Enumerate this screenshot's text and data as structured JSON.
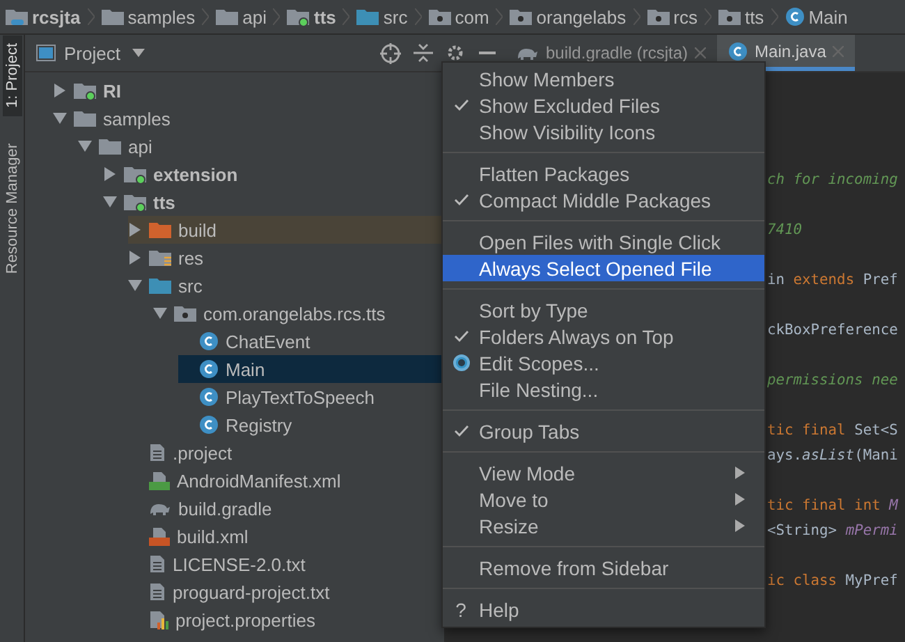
{
  "breadcrumb": [
    {
      "label": "rcsjta",
      "kind": "project"
    },
    {
      "label": "samples",
      "kind": "folder"
    },
    {
      "label": "api",
      "kind": "folder"
    },
    {
      "label": "tts",
      "kind": "module"
    },
    {
      "label": "src",
      "kind": "src"
    },
    {
      "label": "com",
      "kind": "package"
    },
    {
      "label": "orangelabs",
      "kind": "package"
    },
    {
      "label": "rcs",
      "kind": "package"
    },
    {
      "label": "tts",
      "kind": "package"
    },
    {
      "label": "Main",
      "kind": "class"
    }
  ],
  "tool_strip": [
    {
      "label": "1: Project",
      "selected": true
    },
    {
      "label": "Resource Manager",
      "selected": false
    }
  ],
  "project_panel": {
    "title": "Project"
  },
  "editor_tabs": [
    {
      "label": "build.gradle (rcsjta)",
      "kind": "gradle",
      "selected": false
    },
    {
      "label": "Main.java",
      "kind": "class",
      "selected": true
    }
  ],
  "tree": [
    {
      "label": "RI",
      "kind": "module",
      "expanded": false,
      "selected": false
    },
    {
      "label": "samples",
      "kind": "folder",
      "expanded": true,
      "selected": false,
      "children": [
        {
          "label": "api",
          "kind": "folder",
          "expanded": true,
          "selected": false,
          "children": [
            {
              "label": "extension",
              "kind": "module",
              "expanded": false,
              "selected": false
            },
            {
              "label": "tts",
              "kind": "module",
              "expanded": true,
              "selected": false,
              "children": [
                {
                  "label": "build",
                  "kind": "excluded",
                  "expanded": false,
                  "selected": false
                },
                {
                  "label": "res",
                  "kind": "res",
                  "expanded": false,
                  "selected": false
                },
                {
                  "label": "src",
                  "kind": "src",
                  "expanded": true,
                  "selected": false,
                  "children": [
                    {
                      "label": "com.orangelabs.rcs.tts",
                      "kind": "package",
                      "expanded": true,
                      "selected": false,
                      "children": [
                        {
                          "label": "ChatEvent",
                          "kind": "class",
                          "selected": false
                        },
                        {
                          "label": "Main",
                          "kind": "class",
                          "selected": true
                        },
                        {
                          "label": "PlayTextToSpeech",
                          "kind": "class",
                          "selected": false
                        },
                        {
                          "label": "Registry",
                          "kind": "class",
                          "selected": false
                        }
                      ]
                    }
                  ]
                },
                {
                  "label": ".project",
                  "kind": "file",
                  "selected": false
                },
                {
                  "label": "AndroidManifest.xml",
                  "kind": "manifest",
                  "selected": false
                },
                {
                  "label": "build.gradle",
                  "kind": "gradle",
                  "selected": false
                },
                {
                  "label": "build.xml",
                  "kind": "xml",
                  "selected": false
                },
                {
                  "label": "LICENSE-2.0.txt",
                  "kind": "file",
                  "selected": false
                },
                {
                  "label": "proguard-project.txt",
                  "kind": "file",
                  "selected": false
                },
                {
                  "label": "project.properties",
                  "kind": "properties",
                  "selected": false
                }
              ]
            }
          ]
        }
      ]
    }
  ],
  "code_blocks": [
    [
      [
        {
          "text": "ch for incoming",
          "kind": "comment"
        }
      ]
    ],
    [
      [
        {
          "text": "7410",
          "kind": "comment"
        }
      ]
    ],
    [
      [
        {
          "text": "in ",
          "kind": "plain"
        },
        {
          "text": "extends",
          "kind": "keyword"
        },
        {
          "text": " Pref",
          "kind": "plain"
        }
      ]
    ],
    [
      [
        {
          "text": "ckBoxPreference",
          "kind": "plain"
        }
      ]
    ],
    [
      [
        {
          "text": "permissions nee",
          "kind": "comment"
        }
      ]
    ],
    [
      [
        {
          "text": "tic final",
          "kind": "keyword"
        },
        {
          "text": " Set<S",
          "kind": "plain"
        }
      ],
      [
        {
          "text": "ays.",
          "kind": "plain"
        },
        {
          "text": "asList",
          "kind": "static"
        },
        {
          "text": "(Mani",
          "kind": "plain"
        }
      ]
    ],
    [
      [
        {
          "text": "tic final int",
          "kind": "keyword"
        },
        {
          "text": " M",
          "kind": "field"
        }
      ],
      [
        {
          "text": "<String> ",
          "kind": "plain"
        },
        {
          "text": "mPermi",
          "kind": "field"
        }
      ]
    ],
    [
      [
        {
          "text": "ic class",
          "kind": "keyword"
        },
        {
          "text": " MyPref",
          "kind": "plain"
        }
      ]
    ]
  ],
  "menu_groups": [
    [
      {
        "label": "Show Members",
        "kind": "toggle",
        "checked": false,
        "selected": false
      },
      {
        "label": "Show Excluded Files",
        "kind": "toggle",
        "checked": true,
        "selected": false
      },
      {
        "label": "Show Visibility Icons",
        "kind": "toggle",
        "checked": false,
        "selected": false
      }
    ],
    [
      {
        "label": "Flatten Packages",
        "kind": "toggle",
        "checked": false,
        "selected": false
      },
      {
        "label": "Compact Middle Packages",
        "kind": "toggle",
        "checked": true,
        "selected": false
      }
    ],
    [
      {
        "label": "Open Files with Single Click",
        "kind": "toggle",
        "checked": false,
        "selected": false
      },
      {
        "label": "Always Select Opened File",
        "kind": "toggle",
        "checked": false,
        "selected": true
      }
    ],
    [
      {
        "label": "Sort by Type",
        "kind": "toggle",
        "checked": false,
        "selected": false
      },
      {
        "label": "Folders Always on Top",
        "kind": "toggle",
        "checked": true,
        "selected": false
      },
      {
        "label": "Edit Scopes...",
        "kind": "scopes",
        "selected": false
      },
      {
        "label": "File Nesting...",
        "kind": "action",
        "selected": false
      }
    ],
    [
      {
        "label": "Group Tabs",
        "kind": "toggle",
        "checked": true,
        "selected": false
      }
    ],
    [
      {
        "label": "View Mode",
        "kind": "submenu",
        "selected": false
      },
      {
        "label": "Move to",
        "kind": "submenu",
        "selected": false
      },
      {
        "label": "Resize",
        "kind": "submenu",
        "selected": false
      }
    ],
    [
      {
        "label": "Remove from Sidebar",
        "kind": "action",
        "selected": false
      }
    ],
    [
      {
        "label": "Help",
        "kind": "help",
        "glyph": "?",
        "selected": false
      }
    ]
  ]
}
